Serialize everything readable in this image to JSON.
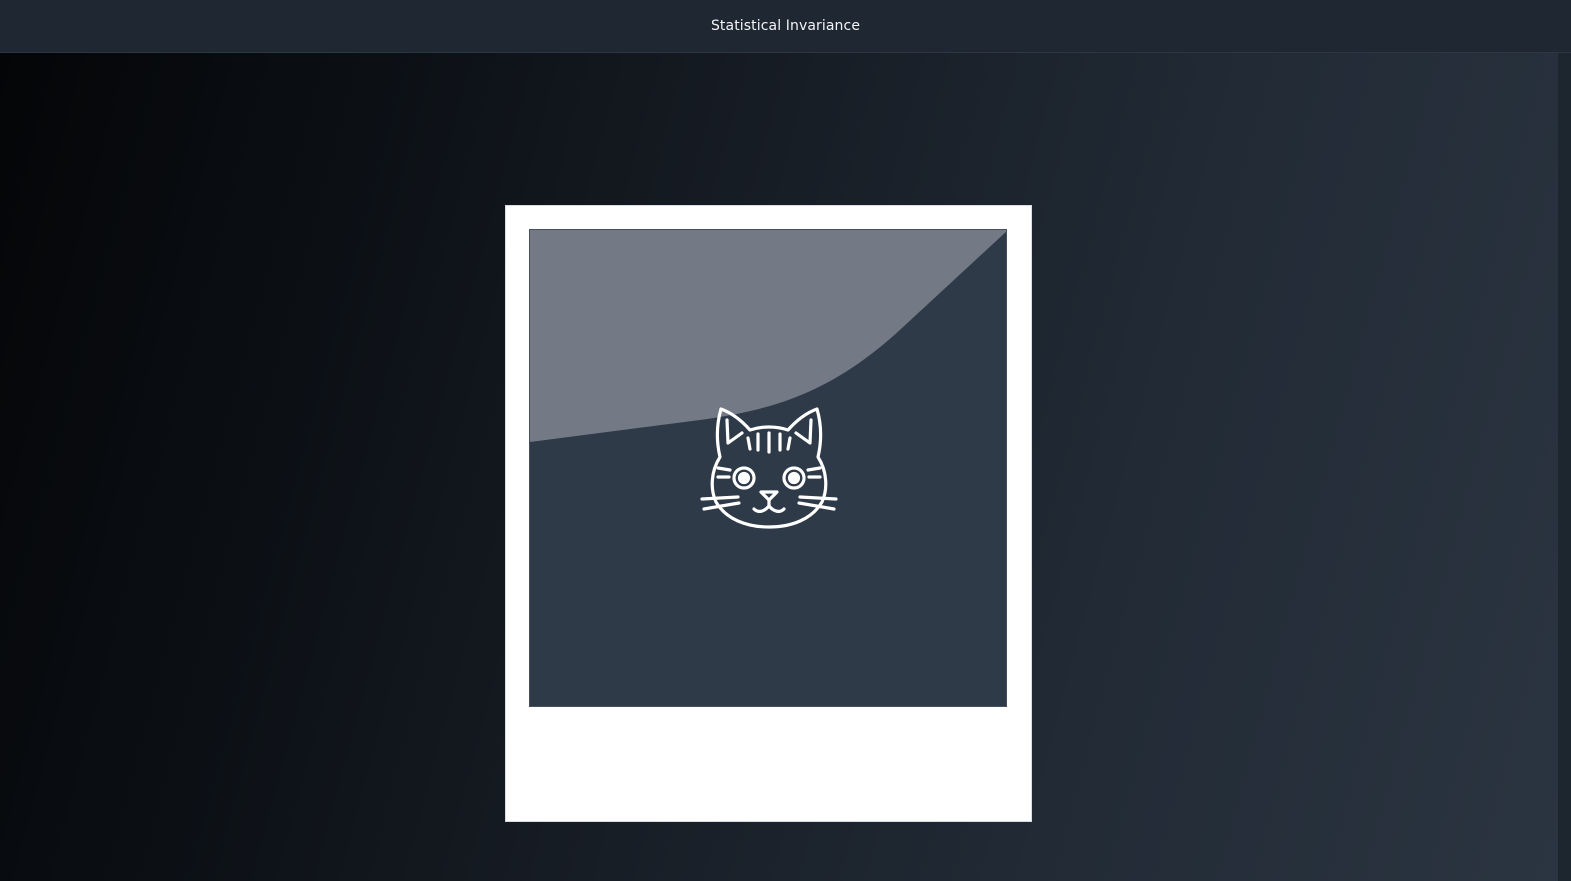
{
  "window": {
    "title": "Statistical Invariance"
  },
  "photo_card": {
    "icon": "cat-face-icon",
    "caption": ""
  },
  "colors": {
    "titlebar": "#1f2832",
    "photo_background": "#2e3a48",
    "glare": "#737a85",
    "card": "#ffffff",
    "icon_stroke": "#ffffff"
  }
}
